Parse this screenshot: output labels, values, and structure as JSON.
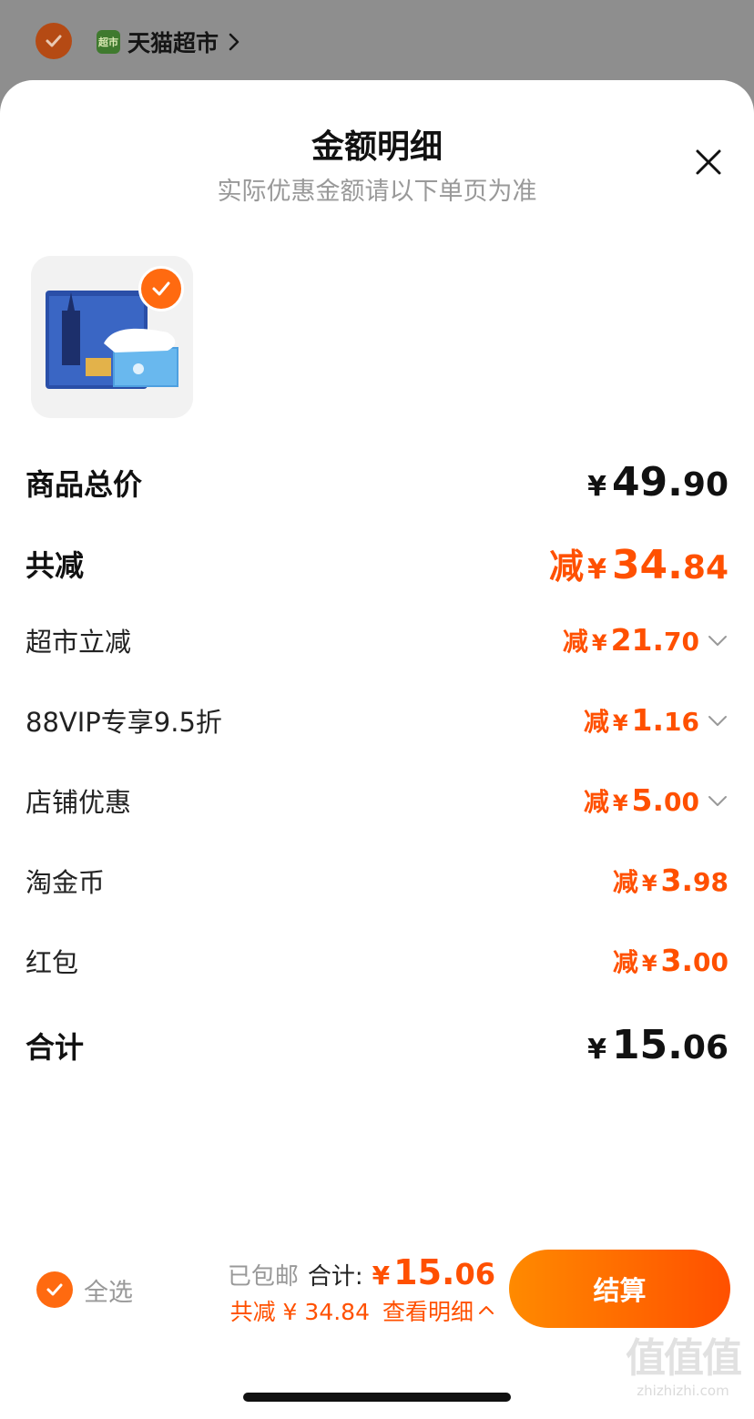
{
  "background": {
    "store_name": "天猫超市",
    "store_logo_text": "超市"
  },
  "sheet": {
    "title": "金额明细",
    "subtitle": "实际优惠金额请以下单页为准",
    "close_icon": "close-icon"
  },
  "product": {
    "image_icon": "tissue-pack-image",
    "checked": true
  },
  "breakdown": {
    "goods_total": {
      "label": "商品总价",
      "yen": "¥",
      "int": "49.",
      "dec": "90"
    },
    "total_discount": {
      "label": "共减",
      "prefix": "减",
      "yen": "¥",
      "int": "34.",
      "dec": "84"
    },
    "items": [
      {
        "label": "超市立减",
        "prefix": "减",
        "yen": "¥",
        "int": "21.",
        "dec": "70",
        "expandable": true
      },
      {
        "label": "88VIP专享9.5折",
        "prefix": "减",
        "yen": "¥",
        "int": "1.",
        "dec": "16",
        "expandable": true
      },
      {
        "label": "店铺优惠",
        "prefix": "减",
        "yen": "¥",
        "int": "5.",
        "dec": "00",
        "expandable": true
      },
      {
        "label": "淘金币",
        "prefix": "减",
        "yen": "¥",
        "int": "3.",
        "dec": "98",
        "expandable": false
      },
      {
        "label": "红包",
        "prefix": "减",
        "yen": "¥",
        "int": "3.",
        "dec": "00",
        "expandable": false
      }
    ],
    "grand_total": {
      "label": "合计",
      "yen": "¥",
      "int": "15.",
      "dec": "06"
    }
  },
  "bottom_bar": {
    "select_all_label": "全选",
    "free_shipping": "已包邮",
    "total_label": "合计:",
    "total_yen": "¥",
    "total_int": "15.",
    "total_dec": "06",
    "discount_text": "共减 ¥ 34.84",
    "view_detail": "查看明细",
    "checkout_label": "结算"
  },
  "watermark": {
    "big": "值值值",
    "small": "zhizhizhi.com"
  },
  "colors": {
    "accent": "#ff5000",
    "check": "#ff6a10",
    "muted": "#999999"
  }
}
